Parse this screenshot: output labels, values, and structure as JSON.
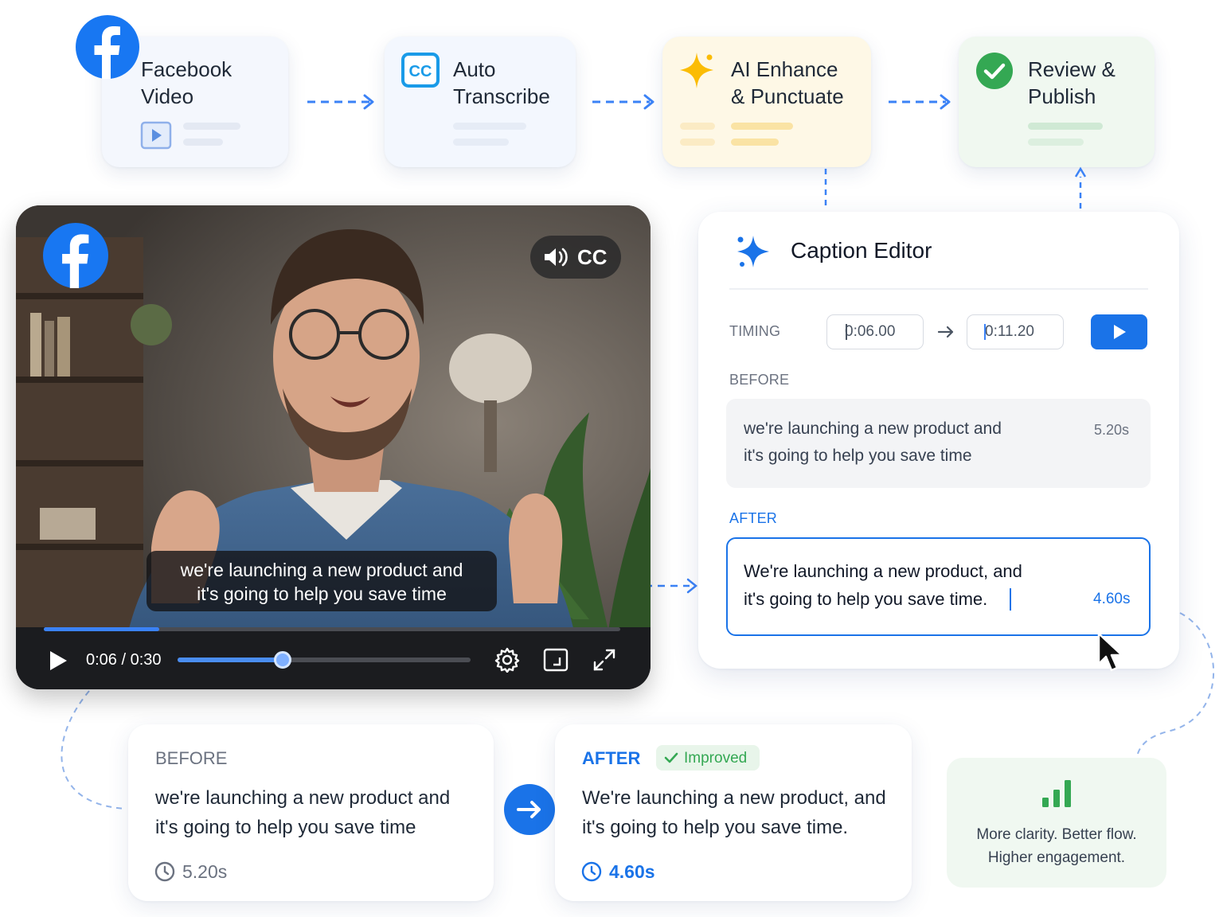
{
  "flow": {
    "steps": [
      {
        "label": "Facebook\nVideo",
        "icon": "facebook-icon"
      },
      {
        "label": "Auto\nTranscribe",
        "icon": "cc-icon"
      },
      {
        "label": "AI Enhance\n& Punctuate",
        "icon": "sparkle-icon"
      },
      {
        "label": "Review &\nPublish",
        "icon": "check-circle-icon"
      }
    ]
  },
  "player": {
    "cc_label": "CC",
    "caption_line1": "we're launching a new product and",
    "caption_line2": "it's going to help you save time",
    "time": "0:06 / 0:30",
    "progress_fraction": 0.2,
    "volume_fraction": 0.36
  },
  "editor": {
    "title": "Caption Editor",
    "timing_label": "TIMING",
    "start_time": "0:06.00",
    "end_time": "0:11.20",
    "before_label": "BEFORE",
    "before_line1": "we're launching a new product and",
    "before_line2": "it's going to help you save time",
    "before_duration": "5.20s",
    "after_label": "AFTER",
    "after_line1": "We're launching a new product, and",
    "after_line2": "it's going to help you save time.",
    "after_duration": "4.60s"
  },
  "compare": {
    "before_label": "BEFORE",
    "before_line1": "we're launching a new product and",
    "before_line2": "it's going to help you save time",
    "before_duration": "5.20s",
    "after_label": "AFTER",
    "improved_badge": "Improved",
    "after_line1": "We're launching a new product, and",
    "after_line2": "it's going to help you save time.",
    "after_duration": "4.60s"
  },
  "insight": {
    "line1": "More clarity. Better flow.",
    "line2": "Higher engagement."
  },
  "colors": {
    "brand_blue": "#1a73e8",
    "facebook_blue": "#1877f2",
    "success_green": "#34a853",
    "sparkle_yellow": "#fbbc04"
  }
}
